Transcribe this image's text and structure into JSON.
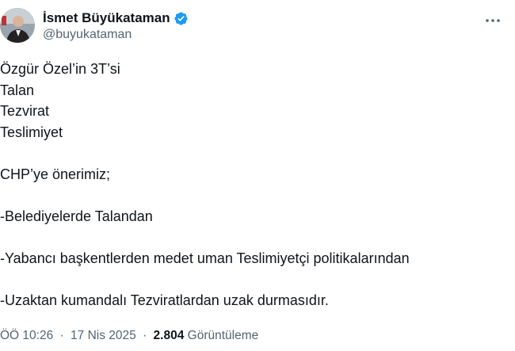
{
  "author": {
    "display_name": "İsmet Büyükataman",
    "handle": "@buyukataman",
    "verified_color": "#1d9bf0"
  },
  "more_icon": "more-horizontal-icon",
  "tweet": {
    "lines": [
      "Özgür Özel’in 3T’si",
      "Talan",
      "Tezvirat",
      "Teslimiyet",
      "",
      "CHP’ye önerimiz;",
      "",
      "-Belediyelerde Talandan",
      "",
      "-Yabancı başkentlerden medet uman Teslimiyetçi politikalarından",
      "",
      "-Uzaktan kumandalı Tezviratlardan uzak durmasıdır."
    ]
  },
  "meta": {
    "time": "ÖÖ 10:26",
    "separator": "·",
    "date": "17 Nis 2025",
    "views_count": "2.804",
    "views_label": "Görüntüleme"
  }
}
